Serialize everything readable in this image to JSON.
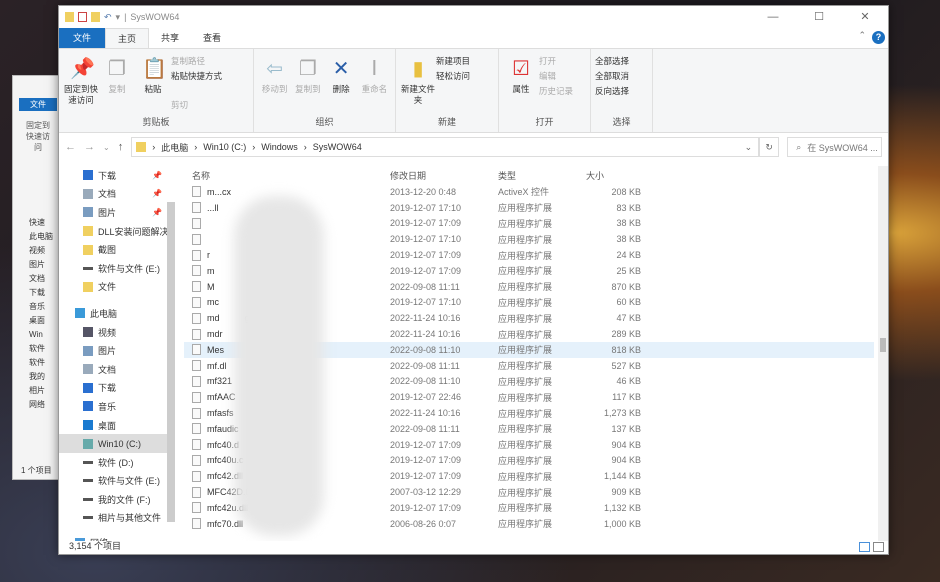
{
  "background_window": {
    "tab_file": "文件",
    "pin_label": "固定到快速访问",
    "nav": [
      "快速",
      "此电脑",
      "视频",
      "图片",
      "文档",
      "下载",
      "音乐",
      "桌面",
      "Win",
      "软件",
      "软件",
      "我的",
      "相片",
      "网络"
    ],
    "status": "1 个项目"
  },
  "window": {
    "title": "SysWOW64",
    "controls": [
      "—",
      "☐",
      "✕"
    ]
  },
  "tabs": [
    "文件",
    "主页",
    "共享",
    "查看"
  ],
  "ribbon": {
    "clipboard": {
      "pin": "固定到快速访问",
      "copy": "复制",
      "paste": "粘贴",
      "copy_path": "复制路径",
      "paste_shortcut": "粘贴快捷方式",
      "cut": "剪切",
      "label": "剪贴板"
    },
    "organize": {
      "move_to": "移动到",
      "copy_to": "复制到",
      "delete": "删除",
      "rename": "重命名",
      "label": "组织"
    },
    "new": {
      "new_folder": "新建文件夹",
      "new_item": "新建项目",
      "easy_access": "轻松访问",
      "label": "新建"
    },
    "open": {
      "properties": "属性",
      "open": "打开",
      "edit": "编辑",
      "history": "历史记录",
      "label": "打开"
    },
    "select": {
      "select_all": "全部选择",
      "select_none": "全部取消",
      "invert": "反向选择",
      "label": "选择"
    }
  },
  "address": {
    "breadcrumb": [
      "此电脑",
      "Win10 (C:)",
      "Windows",
      "SysWOW64"
    ],
    "search_placeholder": "在 SysWOW64 ..."
  },
  "sidebar": [
    {
      "label": "下载",
      "icon": "download",
      "pinned": true,
      "top": true
    },
    {
      "label": "文档",
      "icon": "document",
      "pinned": true,
      "top": true
    },
    {
      "label": "图片",
      "icon": "picture",
      "pinned": true,
      "top": true
    },
    {
      "label": "DLL安装问题解决",
      "icon": "folder",
      "top": true
    },
    {
      "label": "截图",
      "icon": "folder",
      "top": true
    },
    {
      "label": "软件与文件 (E:)",
      "icon": "drive",
      "top": true
    },
    {
      "label": "文件",
      "icon": "folder",
      "top": true
    },
    {
      "label": "此电脑",
      "icon": "pc",
      "root": true
    },
    {
      "label": "视频",
      "icon": "video"
    },
    {
      "label": "图片",
      "icon": "picture"
    },
    {
      "label": "文档",
      "icon": "document"
    },
    {
      "label": "下载",
      "icon": "download"
    },
    {
      "label": "音乐",
      "icon": "music"
    },
    {
      "label": "桌面",
      "icon": "desktop"
    },
    {
      "label": "Win10 (C:)",
      "icon": "drive-c",
      "selected": true
    },
    {
      "label": "软件 (D:)",
      "icon": "drive"
    },
    {
      "label": "软件与文件 (E:)",
      "icon": "drive"
    },
    {
      "label": "我的文件 (F:)",
      "icon": "drive"
    },
    {
      "label": "相片与其他文件",
      "icon": "drive"
    },
    {
      "label": "网络",
      "icon": "network",
      "root": true
    }
  ],
  "columns": [
    "名称",
    "修改日期",
    "类型",
    "大小"
  ],
  "files": [
    {
      "name": "m...cx",
      "date": "2013-12-20 0:48",
      "type": "ActiveX 控件",
      "size": "208 KB"
    },
    {
      "name": "...ll",
      "date": "2019-12-07 17:10",
      "type": "应用程序扩展",
      "size": "83 KB"
    },
    {
      "name": "",
      "date": "2019-12-07 17:09",
      "type": "应用程序扩展",
      "size": "38 KB"
    },
    {
      "name": "",
      "date": "2019-12-07 17:10",
      "type": "应用程序扩展",
      "size": "38 KB"
    },
    {
      "name": "r",
      "date": "2019-12-07 17:09",
      "type": "应用程序扩展",
      "size": "24 KB"
    },
    {
      "name": "m",
      "date": "2019-12-07 17:09",
      "type": "应用程序扩展",
      "size": "25 KB"
    },
    {
      "name": "M",
      "date": "2022-09-08 11:11",
      "type": "应用程序扩展",
      "size": "870 KB"
    },
    {
      "name": "mc",
      "date": "2019-12-07 17:10",
      "type": "应用程序扩展",
      "size": "60 KB"
    },
    {
      "name": "md          gement.dll",
      "date": "2022-11-24 10:16",
      "type": "应用程序扩展",
      "size": "47 KB"
    },
    {
      "name": "mdr          .dll",
      "date": "2022-11-24 10:16",
      "type": "应用程序扩展",
      "size": "289 KB"
    },
    {
      "name": "Mes          Model2.dll",
      "date": "2022-09-08 11:10",
      "type": "应用程序扩展",
      "size": "818 KB",
      "highlight": true
    },
    {
      "name": "mf.dl",
      "date": "2022-09-08 11:11",
      "type": "应用程序扩展",
      "size": "527 KB"
    },
    {
      "name": "mf321",
      "date": "2022-09-08 11:10",
      "type": "应用程序扩展",
      "size": "46 KB"
    },
    {
      "name": "mfAAC",
      "date": "2019-12-07 22:46",
      "type": "应用程序扩展",
      "size": "117 KB"
    },
    {
      "name": "mfasfs",
      "date": "2022-11-24 10:16",
      "type": "应用程序扩展",
      "size": "1,273 KB"
    },
    {
      "name": "mfaudic",
      "date": "2022-09-08 11:11",
      "type": "应用程序扩展",
      "size": "137 KB"
    },
    {
      "name": "mfc40.d",
      "date": "2019-12-07 17:09",
      "type": "应用程序扩展",
      "size": "904 KB"
    },
    {
      "name": "mfc40u.c",
      "date": "2019-12-07 17:09",
      "type": "应用程序扩展",
      "size": "904 KB"
    },
    {
      "name": "mfc42.dll",
      "date": "2019-12-07 17:09",
      "type": "应用程序扩展",
      "size": "1,144 KB"
    },
    {
      "name": "MFC42D.D",
      "date": "2007-03-12 12:29",
      "type": "应用程序扩展",
      "size": "909 KB"
    },
    {
      "name": "mfc42u.dll",
      "date": "2019-12-07 17:09",
      "type": "应用程序扩展",
      "size": "1,132 KB"
    },
    {
      "name": "mfc70.dll",
      "date": "2006-08-26 0:07",
      "type": "应用程序扩展",
      "size": "1,000 KB"
    }
  ],
  "status": "3,154 个项目",
  "colors": {
    "accent": "#1a6fc0",
    "selected_row": "#e5f1fb"
  }
}
